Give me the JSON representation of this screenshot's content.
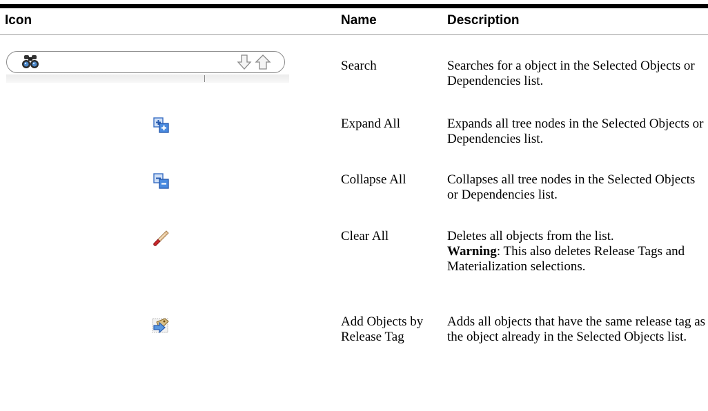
{
  "headers": {
    "icon": "Icon",
    "name": "Name",
    "description": "Description"
  },
  "rows": [
    {
      "name": "Search",
      "description": "Searches for a object in the Selected Objects or Dependencies list.",
      "icon": "search-field-icon"
    },
    {
      "name": "Expand All",
      "description": "Expands all tree nodes in the Selected Objects or Dependencies list.",
      "icon": "expand-all-icon"
    },
    {
      "name": "Collapse All",
      "description": "Collapses all tree nodes in the Selected Objects or Dependencies list.",
      "icon": "collapse-all-icon"
    },
    {
      "name": "Clear All",
      "description": "Deletes all objects from the list.",
      "warning_label": "Warning",
      "warning_text": ": This also deletes Release Tags and Materialization selections.",
      "icon": "eraser-icon"
    },
    {
      "name": "Add Objects by Release Tag",
      "description": "Adds all objects that have the same release tag as the object already in the Selected Objects list.",
      "icon": "add-by-tag-icon"
    }
  ]
}
